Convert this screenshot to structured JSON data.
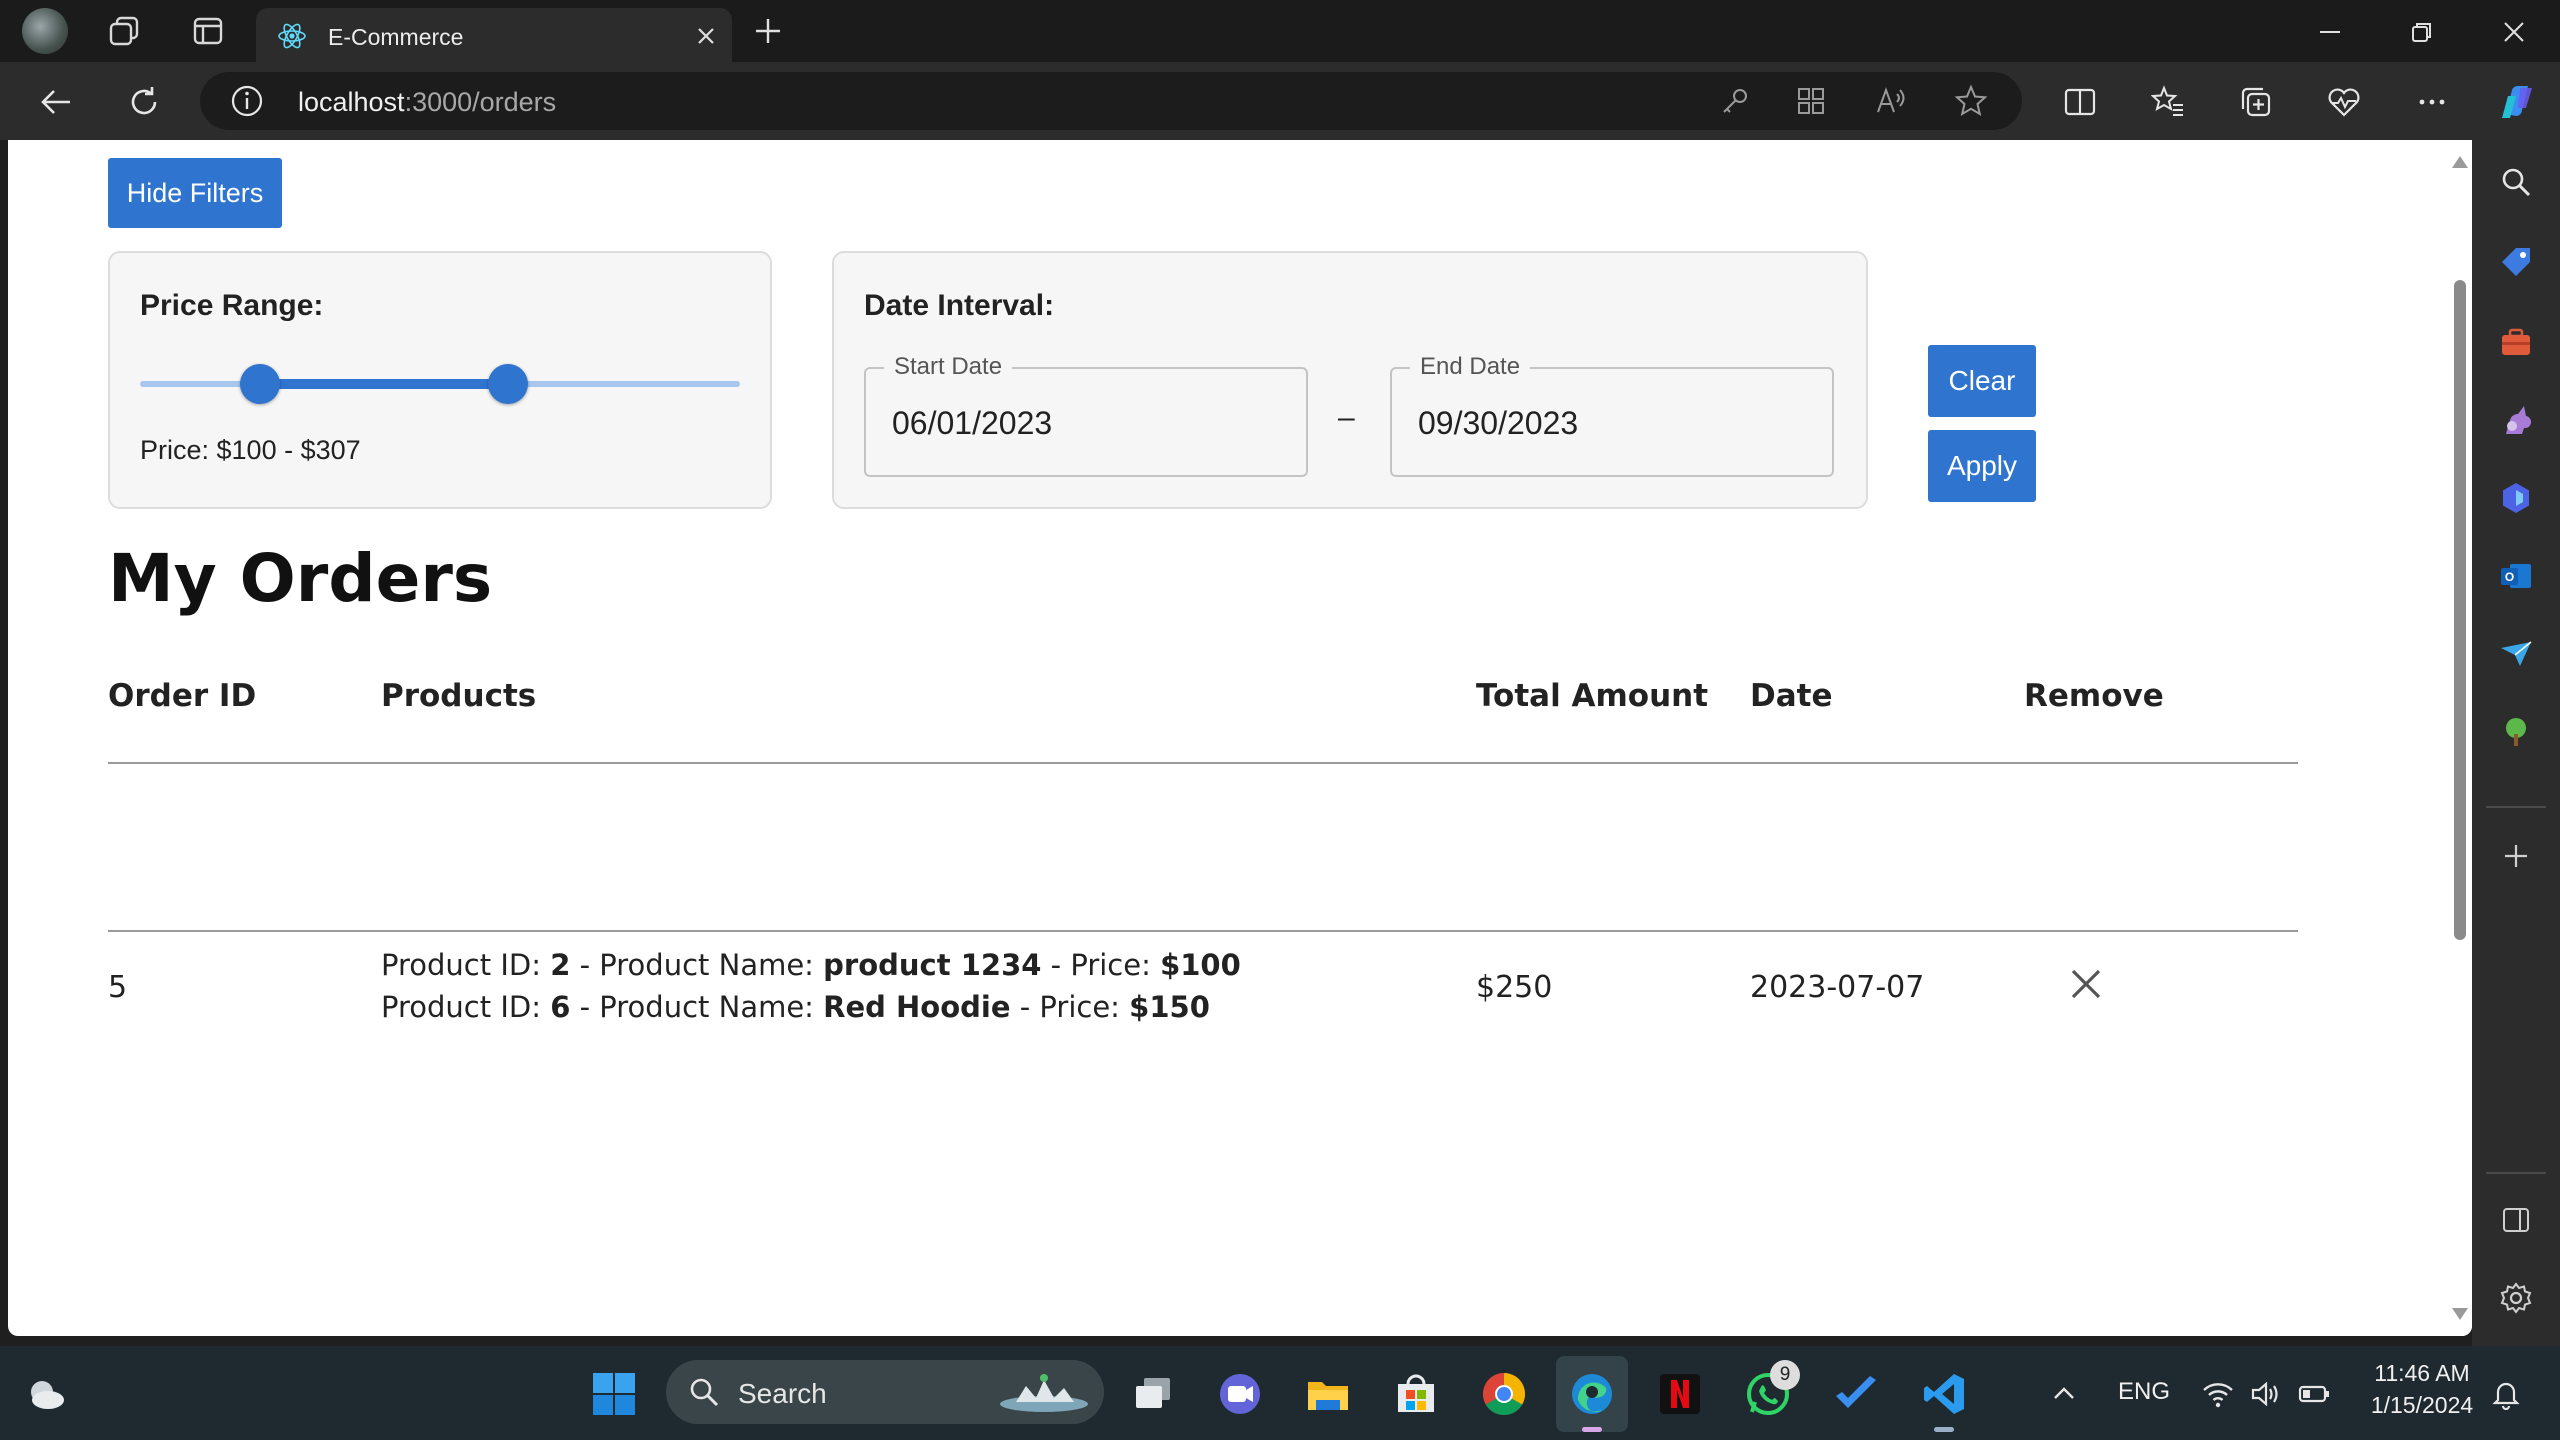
{
  "browser": {
    "tab_title": "E-Commerce",
    "url_host": "localhost",
    "url_path": ":3000/orders"
  },
  "filters": {
    "toggle_label": "Hide Filters",
    "price": {
      "title": "Price Range:",
      "text": "Price: $100 - $307",
      "low_fraction": 0.2,
      "high_fraction": 0.614
    },
    "date": {
      "title": "Date Interval:",
      "start_label": "Start Date",
      "start_value": "06/01/2023",
      "separator": "–",
      "end_label": "End Date",
      "end_value": "09/30/2023"
    },
    "clear_label": "Clear",
    "apply_label": "Apply"
  },
  "orders": {
    "title": "My Orders",
    "columns": [
      "Order ID",
      "Products",
      "Total Amount",
      "Date",
      "Remove"
    ],
    "rows": [
      {
        "order_id": "5",
        "products": [
          {
            "id_label": "Product ID: ",
            "id": "2",
            "name_label": " - Product Name: ",
            "name": "product 1234",
            "price_label": " - Price: ",
            "price": "$100"
          },
          {
            "id_label": "Product ID: ",
            "id": "6",
            "name_label": " - Product Name: ",
            "name": "Red Hoodie",
            "price_label": " - Price: ",
            "price": "$150"
          }
        ],
        "total": "$250",
        "date": "2023-07-07",
        "remove_icon": "close-icon"
      }
    ]
  },
  "taskbar": {
    "search_placeholder": "Search",
    "language": "ENG",
    "time": "11:46 AM",
    "date": "1/15/2024",
    "whatsapp_badge": "9"
  },
  "colors": {
    "accent": "#2f75cf",
    "slider_rail": "#a8c6ee"
  }
}
